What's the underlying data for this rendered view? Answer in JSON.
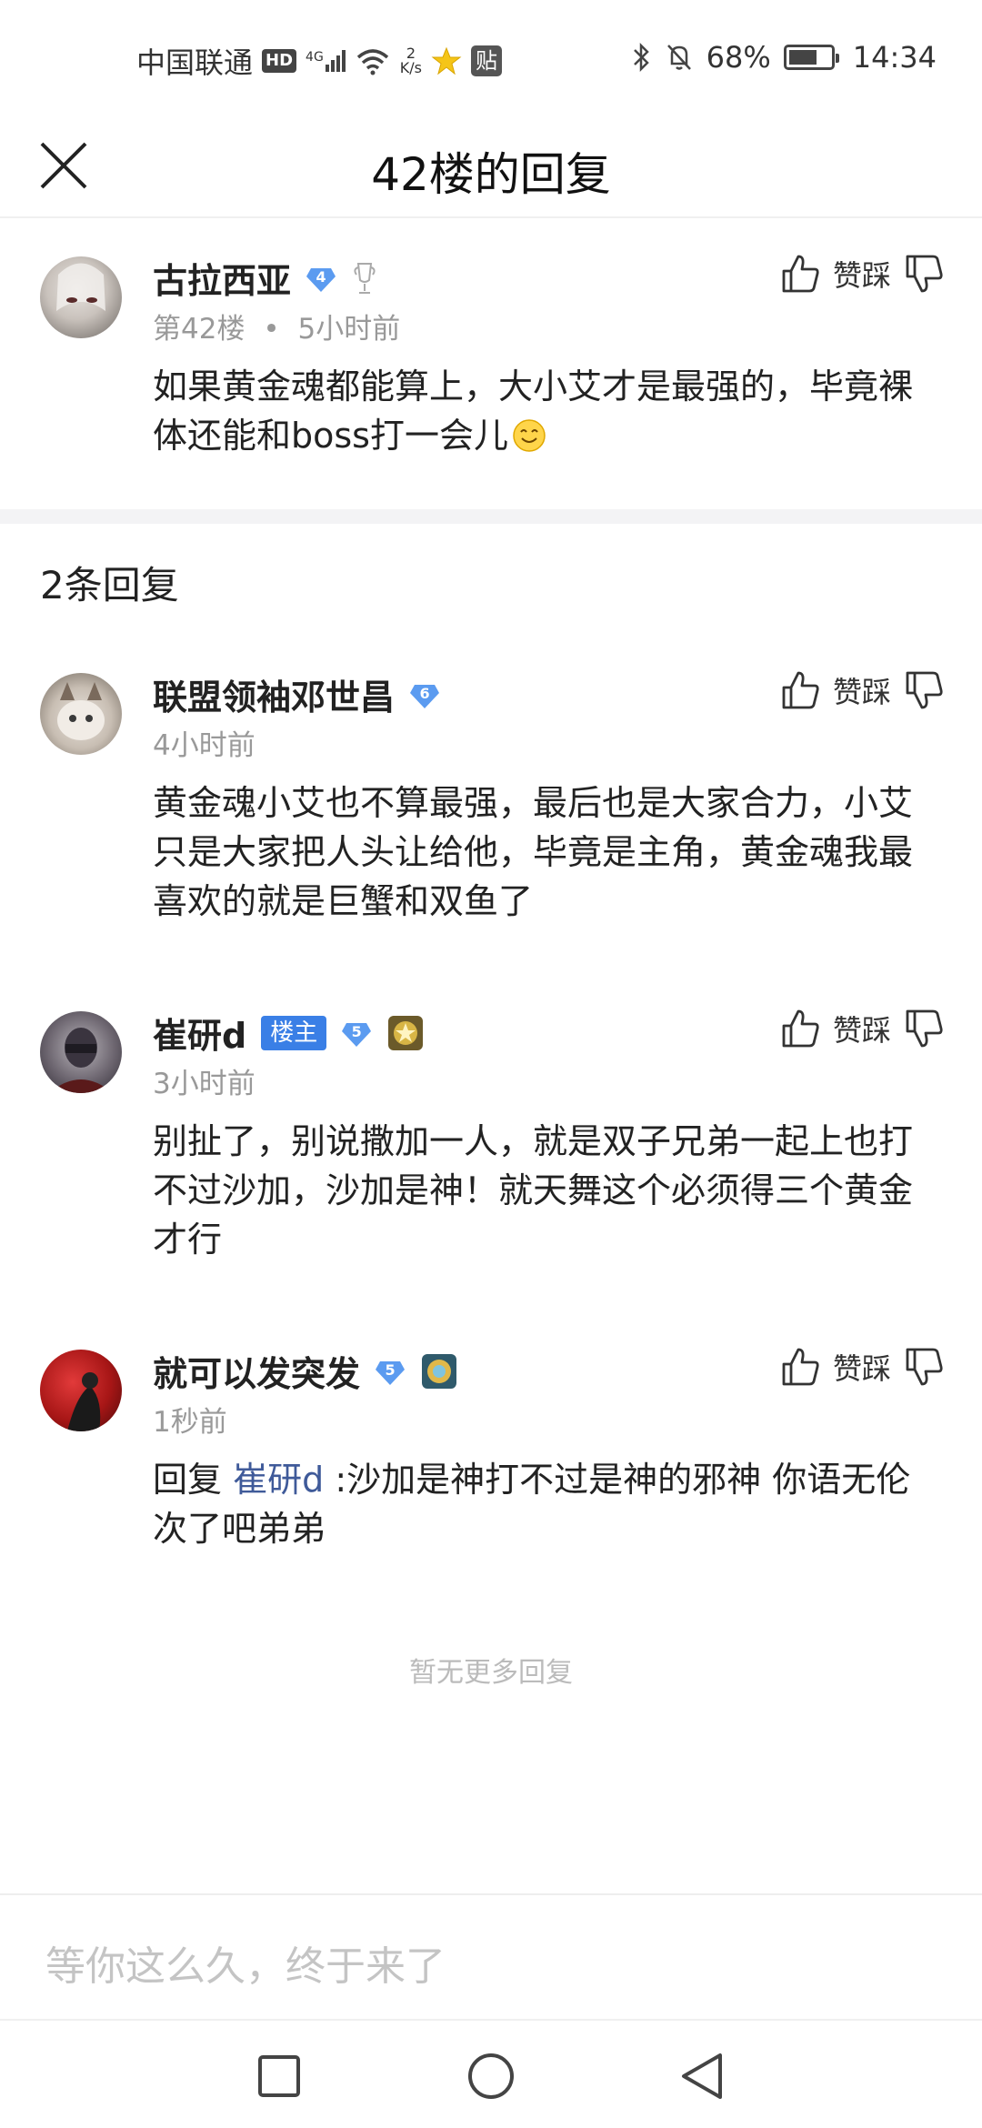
{
  "status_bar": {
    "carrier": "中国联通",
    "hd": "HD",
    "network": "4G",
    "speed_top": "2",
    "speed_bottom": "K/s",
    "tieba_badge": "贴",
    "battery": "68%",
    "battery_level": 0.68,
    "time": "14:34"
  },
  "header": {
    "title": "42楼的回复"
  },
  "main_comment": {
    "username": "古拉西亚",
    "level": "4",
    "floor": "第42楼",
    "separator": "•",
    "time": "5小时前",
    "text": "如果黄金魂都能算上，大小艾才是最强的，毕竟裸体还能和boss打一会儿",
    "vote_label": "赞踩"
  },
  "reply_count": "2条回复",
  "replies": [
    {
      "username": "联盟领袖邓世昌",
      "level": "6",
      "time": "4小时前",
      "text": "黄金魂小艾也不算最强，最后也是大家合力，小艾只是大家把人头让给他，毕竟是主角，黄金魂我最喜欢的就是巨蟹和双鱼了",
      "vote_label": "赞踩"
    },
    {
      "username": "崔研d",
      "badge": "楼主",
      "level": "5",
      "time": "3小时前",
      "text": "别扯了，别说撒加一人，就是双子兄弟一起上也打不过沙加，沙加是神！就天舞这个必须得三个黄金才行",
      "vote_label": "赞踩"
    },
    {
      "username": "就可以发突发",
      "level": "5",
      "time": "1秒前",
      "reply_prefix": "回复",
      "reply_to": "崔研d",
      "text": ":沙加是神打不过是神的邪神 你语无伦次了吧弟弟",
      "vote_label": "赞踩"
    }
  ],
  "no_more": "暂无更多回复",
  "input": {
    "placeholder": "等你这么久，终于来了"
  },
  "colors": {
    "accent": "#3a7fe6",
    "link": "#3f5a99",
    "level_badge": "#5b9bf0"
  }
}
